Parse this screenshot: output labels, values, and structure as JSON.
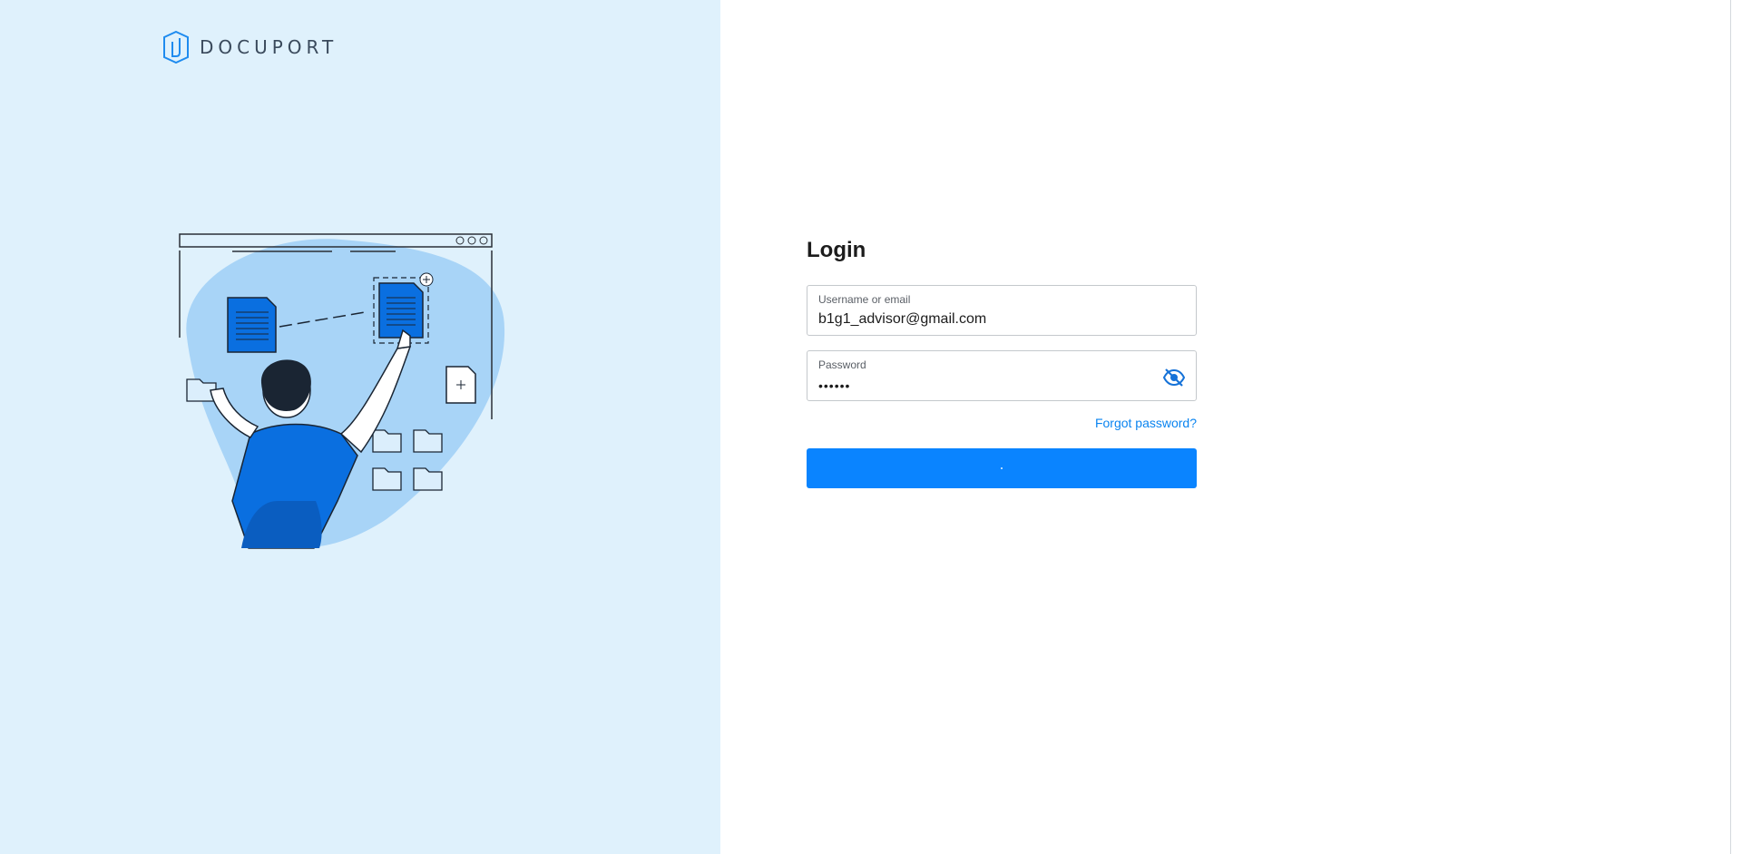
{
  "brand": {
    "name": "DOCUPORT",
    "logo_icon": "docuport-logo-icon",
    "color": "#1e8bef"
  },
  "illustration": {
    "icon": "person-organizing-documents-illustration"
  },
  "login": {
    "title": "Login",
    "username": {
      "label": "Username or email",
      "value": "b1g1_advisor@gmail.com"
    },
    "password": {
      "label": "Password",
      "value": "••••••",
      "toggle_icon": "eye-off-icon"
    },
    "forgot_password": "Forgot password?",
    "submit_state": "loading"
  },
  "colors": {
    "left_panel_bg": "#dff1fc",
    "accent": "#0a84ff",
    "link": "#0a84f0"
  }
}
